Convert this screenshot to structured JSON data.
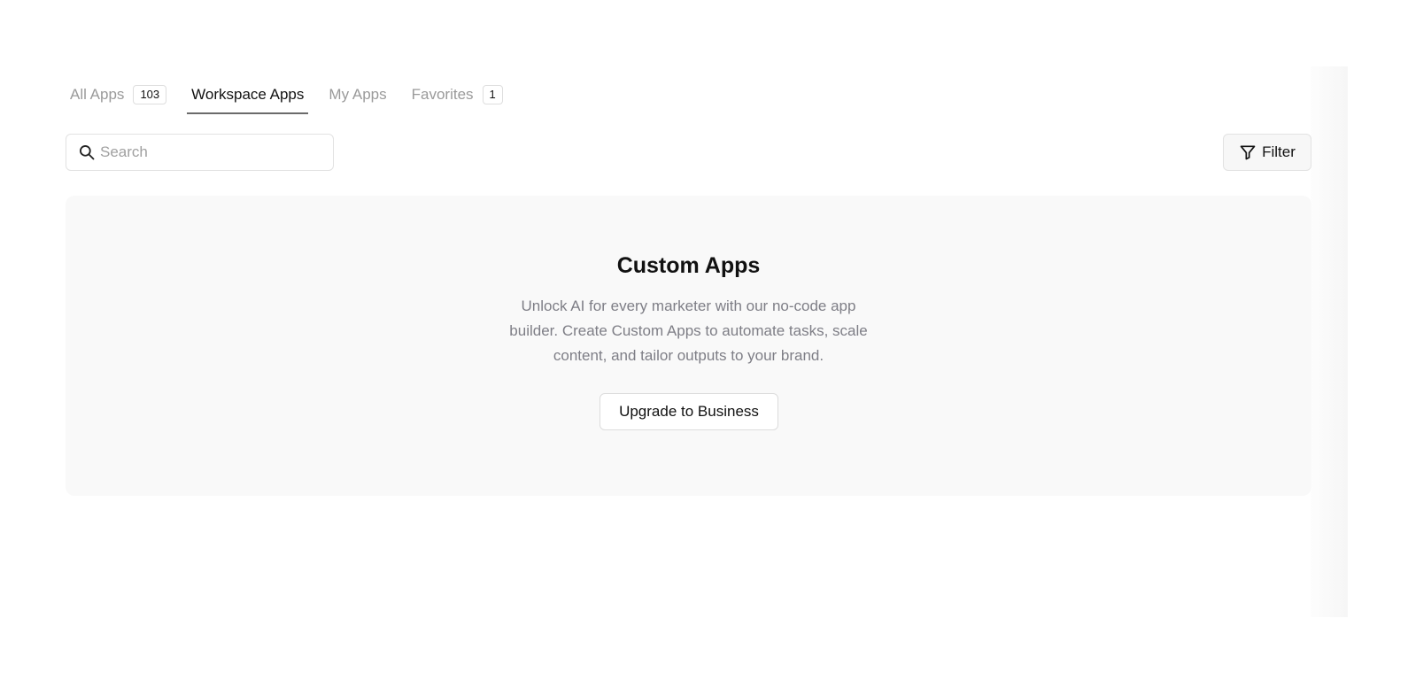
{
  "tabs": [
    {
      "label": "All Apps",
      "count": "103",
      "active": false
    },
    {
      "label": "Workspace Apps",
      "active": true
    },
    {
      "label": "My Apps",
      "active": false
    },
    {
      "label": "Favorites",
      "count": "1",
      "active": false
    }
  ],
  "search": {
    "placeholder": "Search",
    "value": "",
    "icon": "search-icon"
  },
  "filter": {
    "label": "Filter",
    "icon": "filter-icon"
  },
  "custom_apps": {
    "title": "Custom Apps",
    "description": "Unlock AI for every marketer with our no-code app builder. Create Custom Apps to automate tasks, scale content, and tailor outputs to your brand.",
    "upgrade_label": "Upgrade to Business"
  },
  "colors": {
    "active_underline": "#6b6b6b",
    "inactive_tab": "#9a9a9a",
    "card_background": "#f9f9f9",
    "description_text": "#7e7e86"
  }
}
